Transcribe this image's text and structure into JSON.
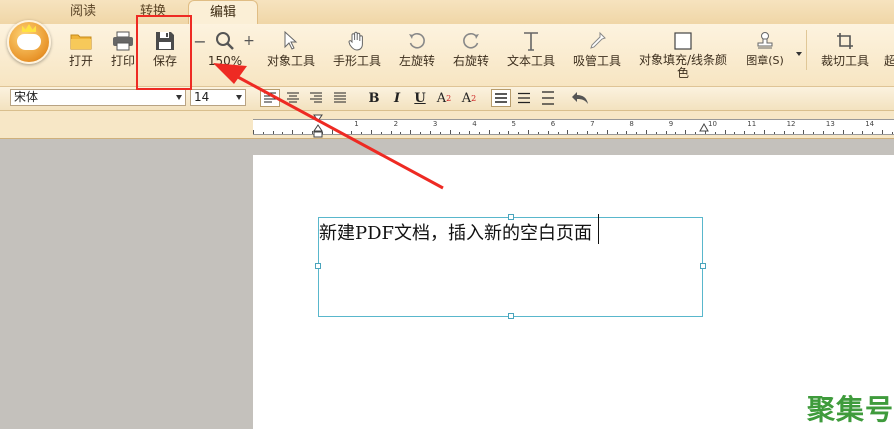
{
  "tabs": [
    {
      "label": "阅读"
    },
    {
      "label": "转换"
    },
    {
      "label": "编辑"
    }
  ],
  "toolbar": {
    "open": "打开",
    "print": "打印",
    "save": "保存",
    "zoom_level": "150%",
    "zoom_minus": "−",
    "zoom_plus": "+",
    "object_tool": "对象工具",
    "hand_tool": "手形工具",
    "rotate_left": "左旋转",
    "rotate_right": "右旋转",
    "text_tool": "文本工具",
    "eyedropper_tool": "吸管工具",
    "fill_stroke_color": "对象填充/线条颜色",
    "stamp": "图章(S)",
    "crop_tool": "裁切工具",
    "overflow_label": "超"
  },
  "format": {
    "font_name": "宋体",
    "font_size": "14",
    "bold": "B",
    "italic": "I",
    "underline": "U",
    "superscript": "A",
    "superscript_mark": "2",
    "subscript": "A",
    "subscript_mark": "2"
  },
  "ruler": {
    "labels": [
      "1",
      "2",
      "3",
      "4",
      "5",
      "6",
      "7",
      "8",
      "9",
      "10",
      "11",
      "12",
      "13",
      "14"
    ]
  },
  "document": {
    "text": "新建PDF文档，插入新的空白页面"
  },
  "watermark": "聚集号",
  "colors": {
    "highlight": "#ee2a23",
    "selection_border": "#59b7cc",
    "watermark": "#3f9b3c"
  }
}
